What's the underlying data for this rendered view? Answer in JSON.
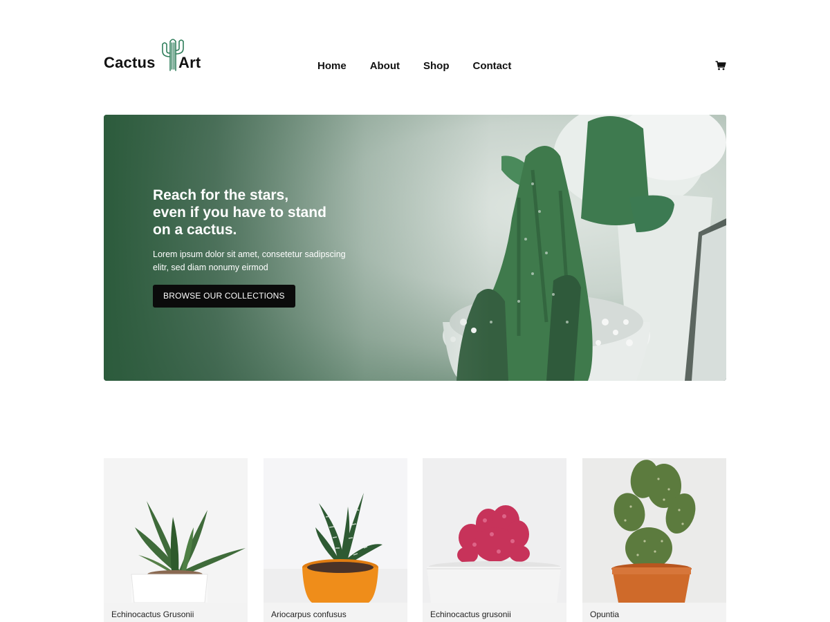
{
  "brand": {
    "name_left": "Cactus",
    "name_right": "Art",
    "logo_icon": "cactus-icon"
  },
  "nav": [
    {
      "label": "Home"
    },
    {
      "label": "About"
    },
    {
      "label": "Shop"
    },
    {
      "label": "Contact"
    }
  ],
  "cart": {
    "icon": "cart-icon"
  },
  "hero": {
    "title_line1": "Reach for the stars,",
    "title_line2": "even if you have to stand",
    "title_line3": "on a cactus.",
    "text": "Lorem ipsum dolor sit amet, consetetur sadipscing elitr, sed diam nonumy eirmod",
    "button_label": "BROWSE OUR COLLECTIONS"
  },
  "products": [
    {
      "name": "Echinocactus Grusonii"
    },
    {
      "name": "Ariocarpus confusus"
    },
    {
      "name": "Echinocactus grusonii"
    },
    {
      "name": "Opuntia"
    }
  ],
  "colors": {
    "hero_dark_green": "#2c5b3c",
    "button_black": "#0b0b0b",
    "logo_green": "#2e7d5a",
    "caption_bg": "#f3f3f3"
  }
}
